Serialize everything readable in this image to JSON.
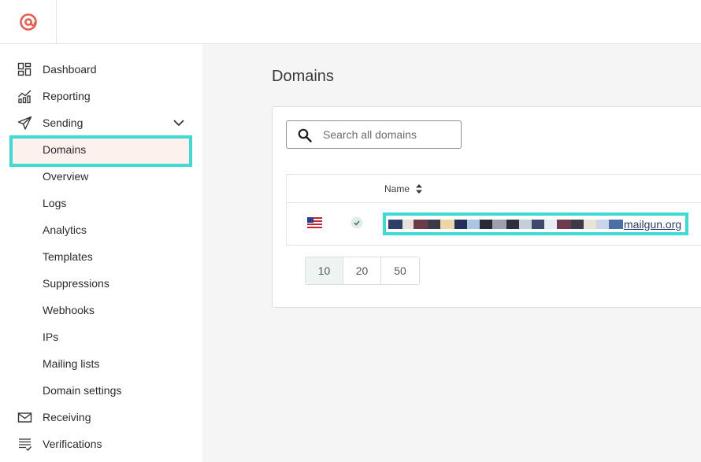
{
  "brand": {
    "logo_icon": "at-sign-logo-icon",
    "accent_color": "#e85e4f",
    "highlight_color": "#3ddbd3"
  },
  "sidebar": {
    "items": [
      {
        "label": "Dashboard",
        "icon": "dashboard-icon"
      },
      {
        "label": "Reporting",
        "icon": "reporting-chart-icon"
      },
      {
        "label": "Sending",
        "icon": "send-paper-plane-icon",
        "expanded": true
      },
      {
        "label": "Domains",
        "sub": true,
        "active": true
      },
      {
        "label": "Overview",
        "sub": true
      },
      {
        "label": "Logs",
        "sub": true
      },
      {
        "label": "Analytics",
        "sub": true
      },
      {
        "label": "Templates",
        "sub": true
      },
      {
        "label": "Suppressions",
        "sub": true
      },
      {
        "label": "Webhooks",
        "sub": true
      },
      {
        "label": "IPs",
        "sub": true
      },
      {
        "label": "Mailing lists",
        "sub": true
      },
      {
        "label": "Domain settings",
        "sub": true
      },
      {
        "label": "Receiving",
        "icon": "envelope-icon"
      },
      {
        "label": "Verifications",
        "icon": "checklist-icon"
      }
    ]
  },
  "main": {
    "title": "Domains",
    "search": {
      "placeholder": "Search all domains",
      "value": ""
    },
    "table": {
      "columns": [
        {
          "label": "Name",
          "sortable": true
        }
      ],
      "rows": [
        {
          "region": "us-flag-icon",
          "status": "verified",
          "domain_suffix": "mailgun.org"
        }
      ]
    },
    "pagination": {
      "options": [
        "10",
        "20",
        "50"
      ],
      "selected": "10"
    }
  }
}
